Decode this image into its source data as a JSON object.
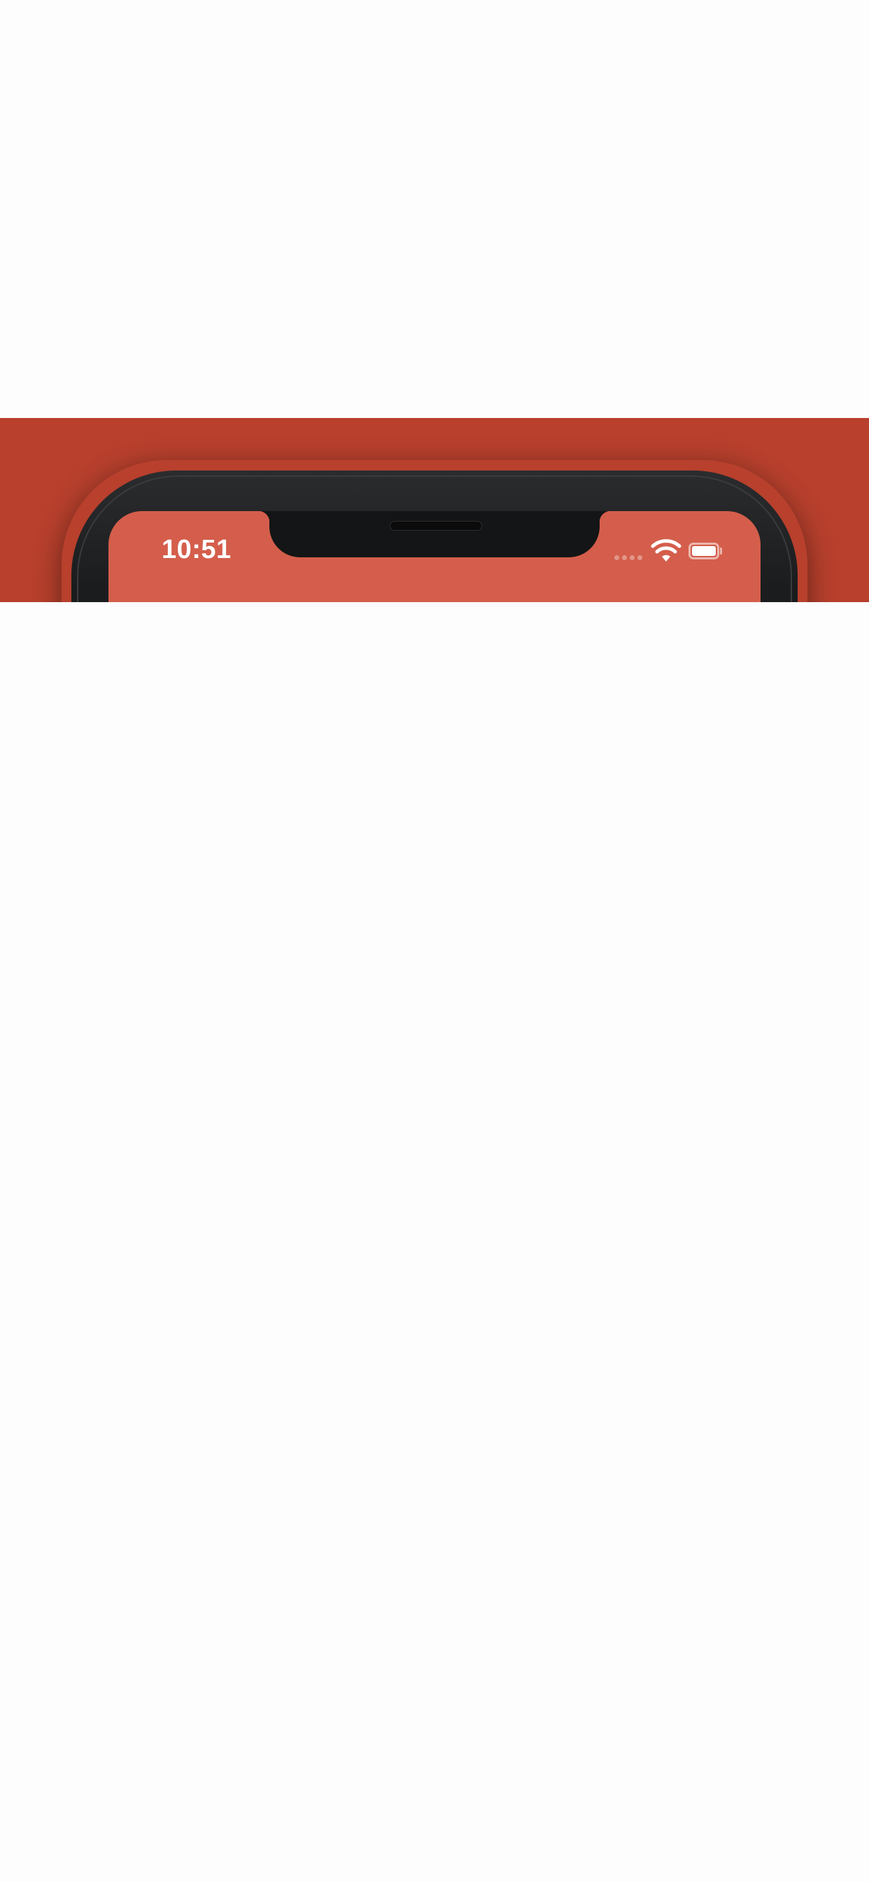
{
  "status_bar": {
    "time": "10:51",
    "signal_icon": "cellular-signal-icon",
    "wifi_icon": "wifi-icon",
    "battery_icon": "battery-icon",
    "battery_level": 1.0
  },
  "colors": {
    "banner": "#b8402d",
    "screen": "#d45e4b",
    "device_frame": "#1b1c1e",
    "page_background": "#fdfdfd"
  }
}
